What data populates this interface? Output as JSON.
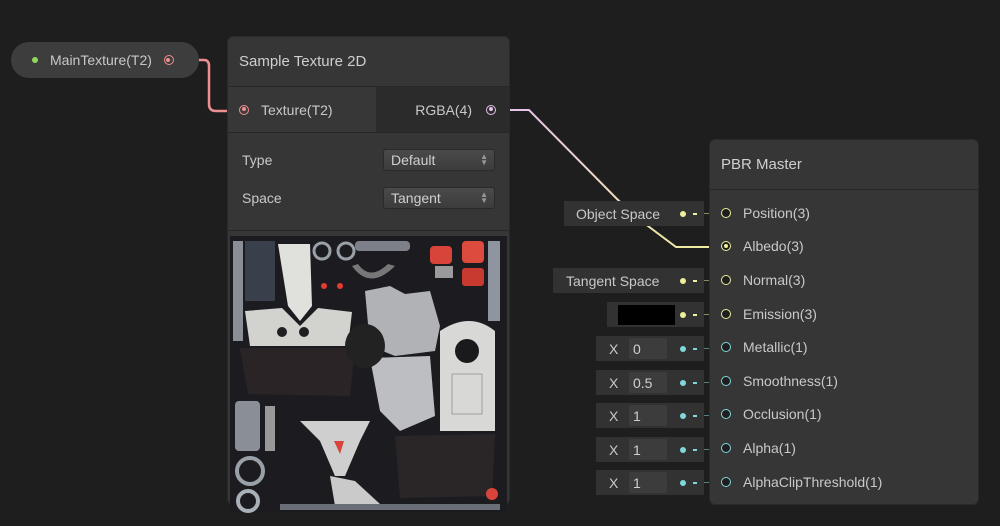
{
  "property_node": {
    "label": "MainTexture(T2)",
    "status_color": "#8fd85b"
  },
  "sample_texture_node": {
    "title": "Sample Texture 2D",
    "input": {
      "label": "Texture(T2)",
      "port_color": "#f08f8f"
    },
    "output": {
      "label": "RGBA(4)",
      "port_color": "#e7c1ec"
    },
    "settings": [
      {
        "label": "Type",
        "value": "Default"
      },
      {
        "label": "Space",
        "value": "Tangent"
      }
    ],
    "preview": "texture-atlas-preview"
  },
  "pbr_master_node": {
    "title": "PBR Master",
    "slots": [
      {
        "label": "Position(3)",
        "type": "vector3",
        "default_widget": "Object Space"
      },
      {
        "label": "Albedo(3)",
        "type": "vector3",
        "connected": true
      },
      {
        "label": "Normal(3)",
        "type": "vector3",
        "default_widget": "Tangent Space"
      },
      {
        "label": "Emission(3)",
        "type": "color",
        "default_color": "#000000"
      },
      {
        "label": "Metallic(1)",
        "type": "vector1",
        "axis": "X",
        "value": "0"
      },
      {
        "label": "Smoothness(1)",
        "type": "vector1",
        "axis": "X",
        "value": "0.5"
      },
      {
        "label": "Occlusion(1)",
        "type": "vector1",
        "axis": "X",
        "value": "1"
      },
      {
        "label": "Alpha(1)",
        "type": "vector1",
        "axis": "X",
        "value": "1"
      },
      {
        "label": "AlphaClipThreshold(1)",
        "type": "vector1",
        "axis": "X",
        "value": "1"
      }
    ]
  },
  "edges": [
    {
      "from": "MainTexture(T2)",
      "to": "Texture(T2)",
      "color": "#f08f8f"
    },
    {
      "from": "RGBA(4)",
      "to": "Albedo(3)",
      "color_start": "#e7c1ec",
      "color_end": "#eeee9c"
    }
  ],
  "colors": {
    "background": "#1e1e1e",
    "node": "#363636",
    "vector3": "#eeee9c",
    "vector1": "#7fd8dc",
    "texture": "#f08f8f"
  }
}
